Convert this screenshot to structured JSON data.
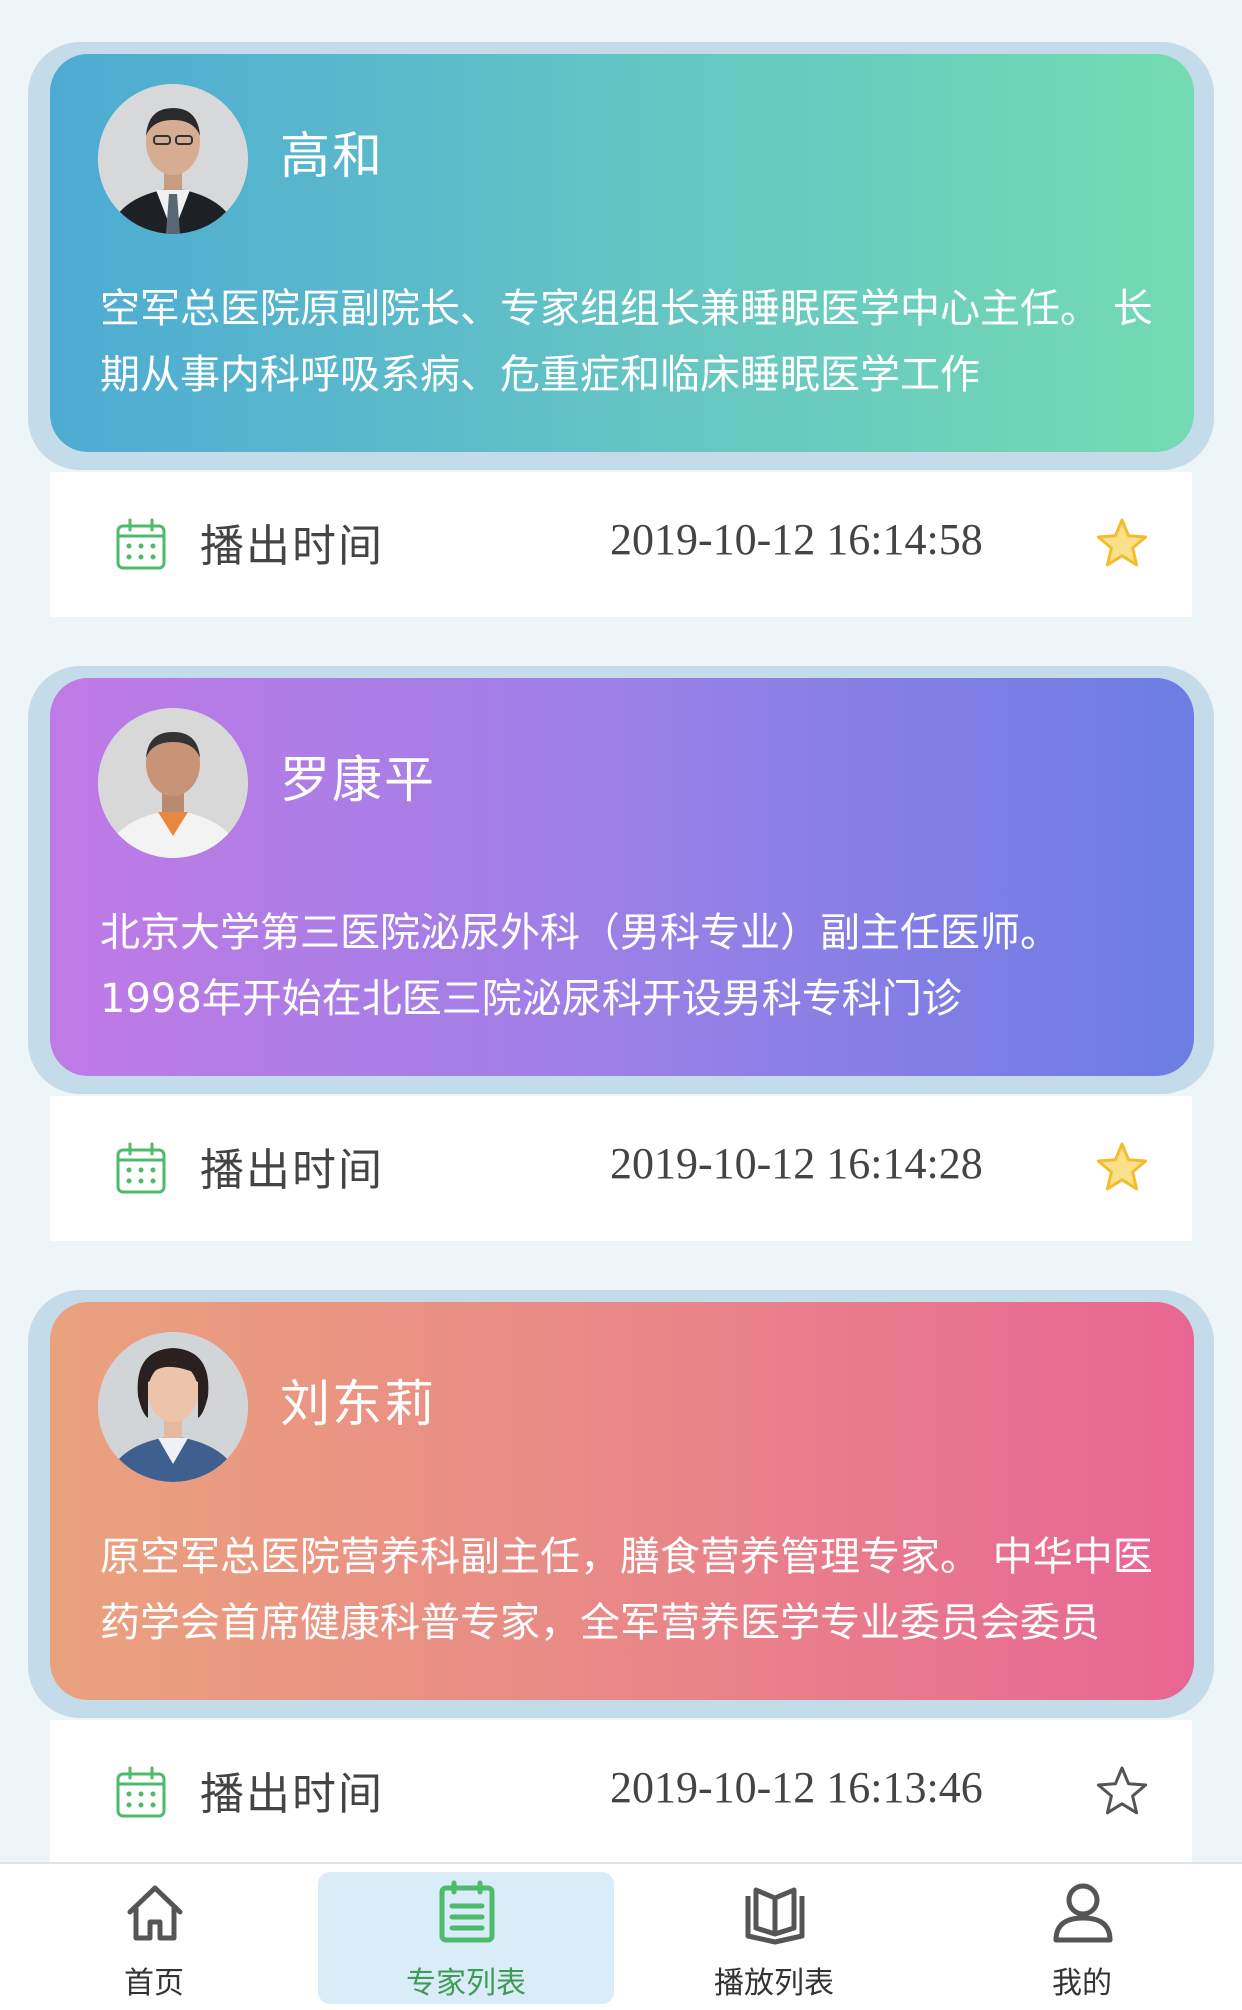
{
  "colors": {
    "accent_green": "#3e9c54",
    "star_gold": "#f5c842"
  },
  "experts": [
    {
      "name": "高和",
      "description": "空军总医院原副院长、专家组组长兼睡眠医学中心主任。 长期从事内科呼吸系病、危重症和临床睡眠医学工作",
      "air_label": "播出时间",
      "air_time": "2019-10-12 16:14:58",
      "favorited": true
    },
    {
      "name": "罗康平",
      "description": "北京大学第三医院泌尿外科（男科专业）副主任医师。 1998年开始在北医三院泌尿科开设男科专科门诊",
      "air_label": "播出时间",
      "air_time": "2019-10-12 16:14:28",
      "favorited": true
    },
    {
      "name": "刘东莉",
      "description": "原空军总医院营养科副主任，膳食营养管理专家。 中华中医药学会首席健康科普专家，全军营养医学专业委员会委员",
      "air_label": "播出时间",
      "air_time": "2019-10-12 16:13:46",
      "favorited": false
    }
  ],
  "tabbar": {
    "home": "首页",
    "experts": "专家列表",
    "playlist": "播放列表",
    "mine": "我的",
    "active": "experts"
  }
}
